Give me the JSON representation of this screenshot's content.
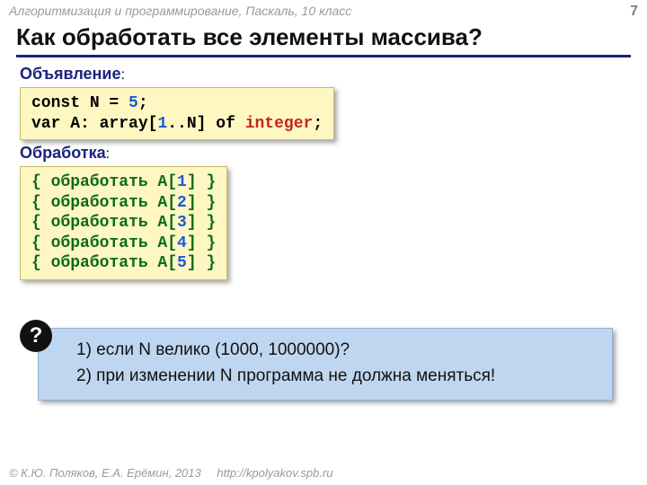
{
  "header": {
    "course": "Алгоритмизация и программирование, Паскаль, 10 класс",
    "page_number": "7"
  },
  "title": "Как обработать все элементы массива?",
  "declaration": {
    "label": "Объявление",
    "colon": ":",
    "parts": {
      "l1_const": "const",
      "l1_n": " N",
      "l1_eq": " =",
      "l1_five": " 5",
      "l1_semi": ";",
      "l2_var": "var",
      "l2_a": " A:",
      "l2_arr": " array",
      "l2_lb": "[",
      "l2_one": "1",
      "l2_rng": "..N]",
      "l2_of": " of ",
      "l2_int": "integer",
      "l2_semi": ";"
    }
  },
  "processing": {
    "label": "Обработка",
    "colon": ":",
    "open": "{ обработать A[",
    "close": "] }",
    "indices": [
      "1",
      "2",
      "3",
      "4",
      "5"
    ]
  },
  "question": {
    "q1": "1) если N велико (1000, 1000000)?",
    "q2": "2) при изменении N программа не должна меняться!",
    "mark": "?"
  },
  "footer": {
    "copyright": "© К.Ю. Поляков, Е.А. Ерёмин, 2013",
    "url": "http://kpolyakov.spb.ru"
  }
}
